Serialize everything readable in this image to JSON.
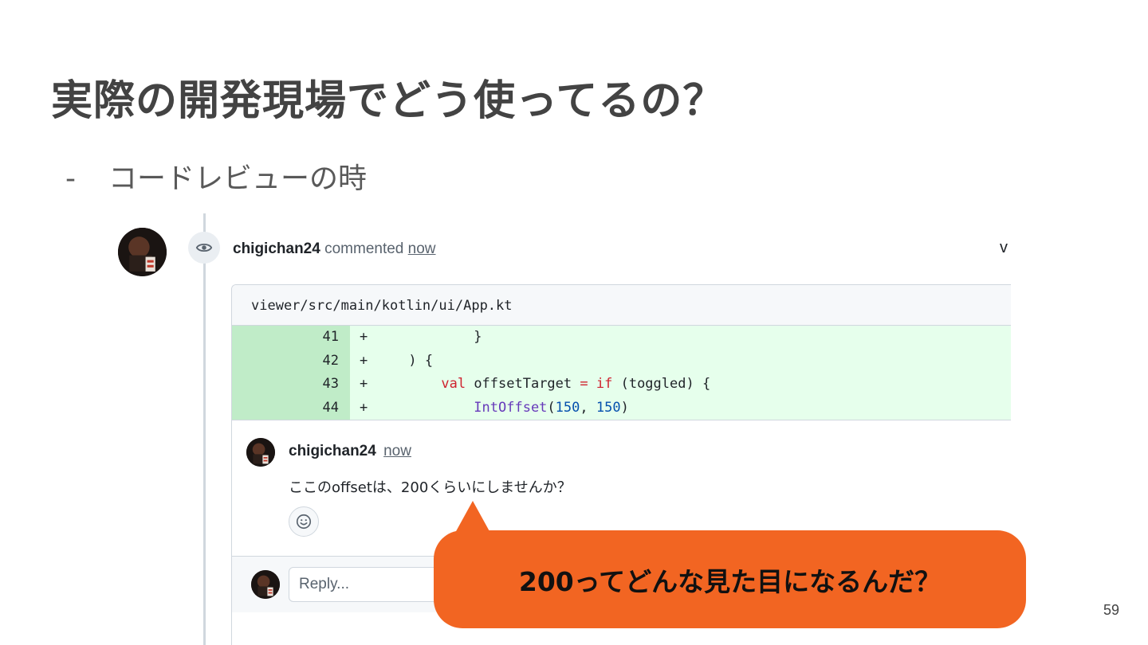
{
  "slide": {
    "title": "実際の開発現場でどう使ってるの？",
    "bullet_dash": "-",
    "bullet_text": "コードレビューの時",
    "page_number": "59"
  },
  "comment": {
    "user": "chigichan24",
    "action": "commented",
    "time": "now",
    "collapse_label": "v"
  },
  "file": {
    "path": "viewer/src/main/kotlin/ui/App.kt"
  },
  "diff_lines": [
    {
      "num": "41",
      "code": "+             }"
    },
    {
      "num": "42",
      "code": "+     ) {"
    },
    {
      "num": "43",
      "code": "+         val offsetTarget = if (toggled) {"
    },
    {
      "num": "44",
      "code": "+             IntOffset(150, 150)"
    }
  ],
  "review": {
    "user": "chigichan24",
    "time": "now",
    "body": "ここのoffsetは、200くらいにしませんか？",
    "reply_placeholder": "Reply..."
  },
  "callout": {
    "text": "200ってどんな見た目になるんだ？"
  },
  "colors": {
    "callout": "#f26522",
    "diff_add_bg": "#e6ffec",
    "diff_add_num_bg": "#c0ecc8"
  }
}
